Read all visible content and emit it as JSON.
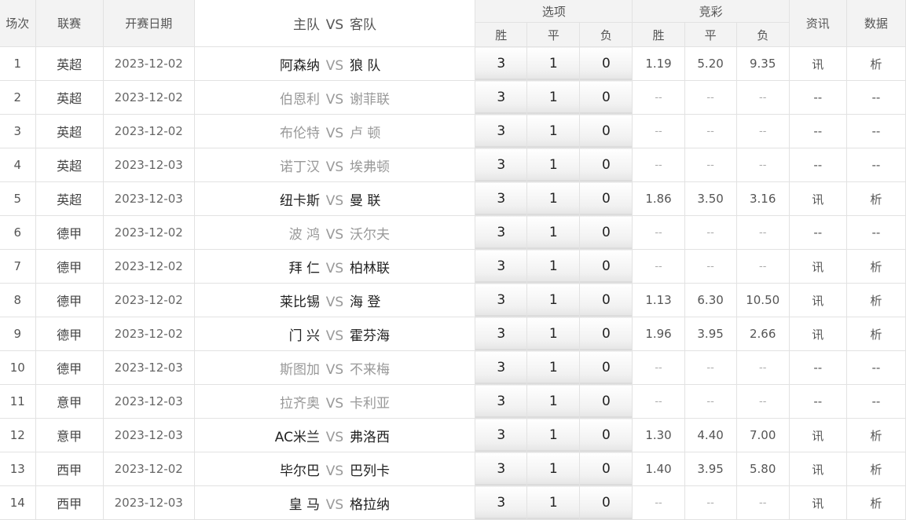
{
  "header": {
    "col_index": "场次",
    "col_league": "联赛",
    "col_date": "开赛日期",
    "col_home": "主队",
    "col_vs": "VS",
    "col_away": "客队",
    "col_options": "选项",
    "col_jingcai": "竞彩",
    "col_news": "资讯",
    "col_data": "数据",
    "sub_win": "胜",
    "sub_draw": "平",
    "sub_lose": "负"
  },
  "rows": [
    {
      "index": "1",
      "league": "英超",
      "date": "2023-12-02",
      "home": "阿森纳",
      "vs": "VS",
      "away": "狼 队",
      "win_opt": "3",
      "draw_opt": "1",
      "lose_opt": "0",
      "odds_win": "1.19",
      "odds_draw": "5.20",
      "odds_lose": "9.35",
      "news": "讯",
      "data": "析",
      "active": true
    },
    {
      "index": "2",
      "league": "英超",
      "date": "2023-12-02",
      "home": "伯恩利",
      "vs": "VS",
      "away": "谢菲联",
      "win_opt": "3",
      "draw_opt": "1",
      "lose_opt": "0",
      "odds_win": "--",
      "odds_draw": "--",
      "odds_lose": "--",
      "news": "--",
      "data": "--",
      "active": false
    },
    {
      "index": "3",
      "league": "英超",
      "date": "2023-12-02",
      "home": "布伦特",
      "vs": "VS",
      "away": "卢 顿",
      "win_opt": "3",
      "draw_opt": "1",
      "lose_opt": "0",
      "odds_win": "--",
      "odds_draw": "--",
      "odds_lose": "--",
      "news": "--",
      "data": "--",
      "active": false
    },
    {
      "index": "4",
      "league": "英超",
      "date": "2023-12-03",
      "home": "诺丁汉",
      "vs": "VS",
      "away": "埃弗顿",
      "win_opt": "3",
      "draw_opt": "1",
      "lose_opt": "0",
      "odds_win": "--",
      "odds_draw": "--",
      "odds_lose": "--",
      "news": "--",
      "data": "--",
      "active": false
    },
    {
      "index": "5",
      "league": "英超",
      "date": "2023-12-03",
      "home": "纽卡斯",
      "vs": "VS",
      "away": "曼 联",
      "win_opt": "3",
      "draw_opt": "1",
      "lose_opt": "0",
      "odds_win": "1.86",
      "odds_draw": "3.50",
      "odds_lose": "3.16",
      "news": "讯",
      "data": "析",
      "active": true
    },
    {
      "index": "6",
      "league": "德甲",
      "date": "2023-12-02",
      "home": "波 鸿",
      "vs": "VS",
      "away": "沃尔夫",
      "win_opt": "3",
      "draw_opt": "1",
      "lose_opt": "0",
      "odds_win": "--",
      "odds_draw": "--",
      "odds_lose": "--",
      "news": "--",
      "data": "--",
      "active": false
    },
    {
      "index": "7",
      "league": "德甲",
      "date": "2023-12-02",
      "home": "拜 仁",
      "vs": "VS",
      "away": "柏林联",
      "win_opt": "3",
      "draw_opt": "1",
      "lose_opt": "0",
      "odds_win": "--",
      "odds_draw": "--",
      "odds_lose": "--",
      "news": "讯",
      "data": "析",
      "active": true
    },
    {
      "index": "8",
      "league": "德甲",
      "date": "2023-12-02",
      "home": "莱比锡",
      "vs": "VS",
      "away": "海 登",
      "win_opt": "3",
      "draw_opt": "1",
      "lose_opt": "0",
      "odds_win": "1.13",
      "odds_draw": "6.30",
      "odds_lose": "10.50",
      "news": "讯",
      "data": "析",
      "active": true
    },
    {
      "index": "9",
      "league": "德甲",
      "date": "2023-12-02",
      "home": "门 兴",
      "vs": "VS",
      "away": "霍芬海",
      "win_opt": "3",
      "draw_opt": "1",
      "lose_opt": "0",
      "odds_win": "1.96",
      "odds_draw": "3.95",
      "odds_lose": "2.66",
      "news": "讯",
      "data": "析",
      "active": true
    },
    {
      "index": "10",
      "league": "德甲",
      "date": "2023-12-03",
      "home": "斯图加",
      "vs": "VS",
      "away": "不来梅",
      "win_opt": "3",
      "draw_opt": "1",
      "lose_opt": "0",
      "odds_win": "--",
      "odds_draw": "--",
      "odds_lose": "--",
      "news": "--",
      "data": "--",
      "active": false
    },
    {
      "index": "11",
      "league": "意甲",
      "date": "2023-12-03",
      "home": "拉齐奥",
      "vs": "VS",
      "away": "卡利亚",
      "win_opt": "3",
      "draw_opt": "1",
      "lose_opt": "0",
      "odds_win": "--",
      "odds_draw": "--",
      "odds_lose": "--",
      "news": "--",
      "data": "--",
      "active": false
    },
    {
      "index": "12",
      "league": "意甲",
      "date": "2023-12-03",
      "home": "AC米兰",
      "vs": "VS",
      "away": "弗洛西",
      "win_opt": "3",
      "draw_opt": "1",
      "lose_opt": "0",
      "odds_win": "1.30",
      "odds_draw": "4.40",
      "odds_lose": "7.00",
      "news": "讯",
      "data": "析",
      "active": true
    },
    {
      "index": "13",
      "league": "西甲",
      "date": "2023-12-02",
      "home": "毕尔巴",
      "vs": "VS",
      "away": "巴列卡",
      "win_opt": "3",
      "draw_opt": "1",
      "lose_opt": "0",
      "odds_win": "1.40",
      "odds_draw": "3.95",
      "odds_lose": "5.80",
      "news": "讯",
      "data": "析",
      "active": true
    },
    {
      "index": "14",
      "league": "西甲",
      "date": "2023-12-03",
      "home": "皇 马",
      "vs": "VS",
      "away": "格拉纳",
      "win_opt": "3",
      "draw_opt": "1",
      "lose_opt": "0",
      "odds_win": "--",
      "odds_draw": "--",
      "odds_lose": "--",
      "news": "讯",
      "data": "析",
      "active": true
    }
  ]
}
